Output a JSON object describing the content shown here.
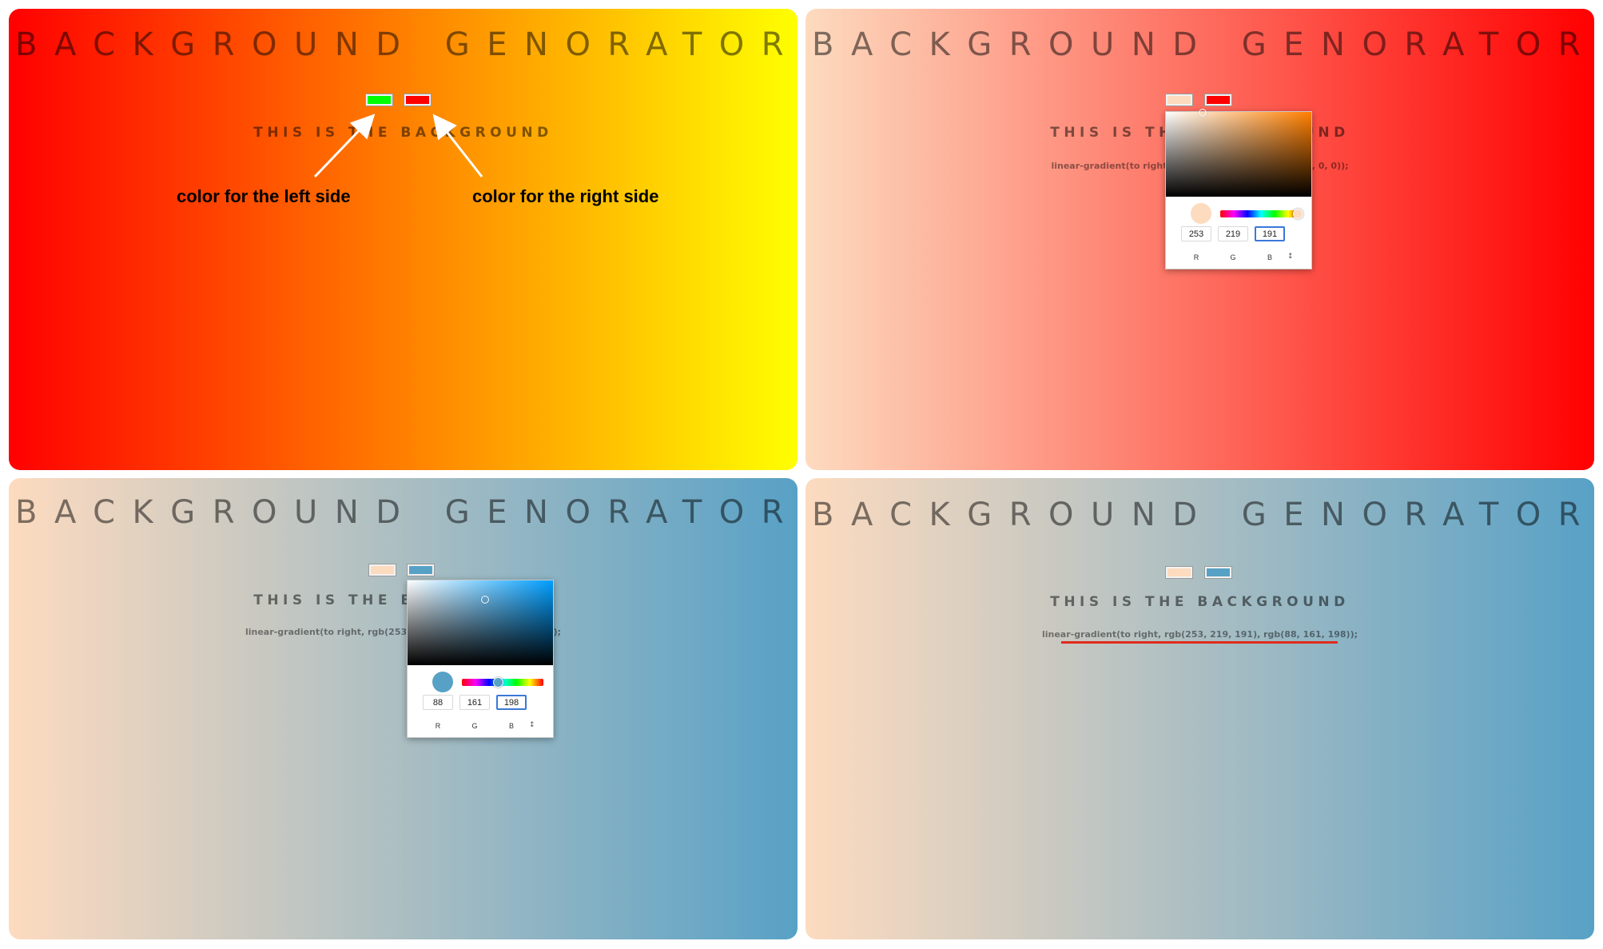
{
  "panels": [
    {
      "title": "BACKGROUND GENORATOR",
      "subtitle": "THIS IS THE BACKGROUND",
      "left_color": "#00ff00",
      "right_color": "#ff0000",
      "annotations": {
        "left": "color for the left side",
        "right": "color for the right side"
      }
    },
    {
      "title": "BACKGROUND GENORATOR",
      "subtitle": "THIS IS THE BACKGROUND",
      "css_text": "linear-gradient(to right, rgb(253, 219, 191), rgb(255, 0, 0));",
      "left_color": "#fddbbf",
      "right_color": "#ff0000",
      "picker": {
        "hue_color": "#ff7f00",
        "preview_color": "#fddbbf",
        "r": "253",
        "g": "219",
        "b": "191",
        "labels": {
          "r": "R",
          "g": "G",
          "b": "B"
        },
        "mode_toggle": "↕"
      }
    },
    {
      "title": "BACKGROUND GENORATOR",
      "subtitle": "THIS IS THE BACKGROUND",
      "css_text": "linear-gradient(to right, rgb(253, 219, 191), rgb(88, 161, 198));",
      "left_color": "#fddbbf",
      "right_color": "#58a1c6",
      "picker": {
        "hue_color": "#009eff",
        "preview_color": "#58a1c6",
        "r": "88",
        "g": "161",
        "b": "198",
        "labels": {
          "r": "R",
          "g": "G",
          "b": "B"
        },
        "mode_toggle": "↕"
      }
    },
    {
      "title": "BACKGROUND GENORATOR",
      "subtitle": "THIS IS THE BACKGROUND",
      "css_text": "linear-gradient(to right, rgb(253, 219, 191), rgb(88, 161, 198));",
      "left_color": "#fddbbf",
      "right_color": "#58a1c6",
      "highlight_color": "#e02b1c"
    }
  ]
}
